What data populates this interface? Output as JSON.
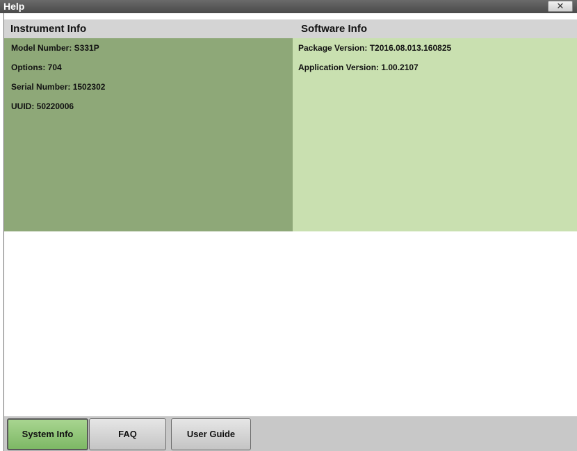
{
  "window": {
    "title": "Help",
    "close_label": "✕"
  },
  "instrument": {
    "header": "Instrument Info",
    "lines": [
      "Model Number: S331P",
      "Options: 704",
      "Serial Number: 1502302",
      "UUID: 50220006"
    ]
  },
  "software": {
    "header": "Software Info",
    "lines": [
      "Package Version: T2016.08.013.160825",
      "Application Version: 1.00.2107"
    ]
  },
  "tabs": [
    {
      "label": "System Info",
      "active": true
    },
    {
      "label": "FAQ",
      "active": false
    },
    {
      "label": "User Guide",
      "active": false
    }
  ],
  "colors": {
    "instrument_panel": "#8ea878",
    "software_panel": "#c9e0b0",
    "active_tab": "#8fc475"
  }
}
